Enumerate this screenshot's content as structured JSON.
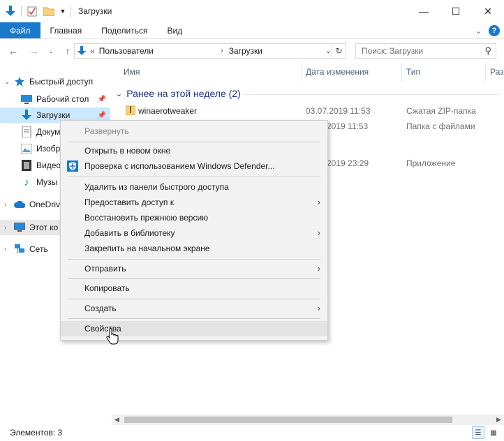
{
  "window": {
    "title": "Загрузки",
    "controls": {
      "minimize": "—",
      "maximize": "☐",
      "close": "✕"
    }
  },
  "ribbon": {
    "tabs": [
      "Файл",
      "Главная",
      "Поделиться",
      "Вид"
    ]
  },
  "address": {
    "overflow": "«",
    "segments": [
      "Пользователи",
      "Загрузки"
    ],
    "search_placeholder": "Поиск: Загрузки"
  },
  "nav": {
    "items": [
      {
        "label": "Быстрый доступ",
        "icon": "star-icon"
      },
      {
        "label": "Рабочий стол",
        "icon": "desktop-icon"
      },
      {
        "label": "Загрузки",
        "icon": "download-arrow-icon"
      },
      {
        "label": "Докум",
        "icon": "documents-icon"
      },
      {
        "label": "Изобр",
        "icon": "pictures-icon"
      },
      {
        "label": "Видео",
        "icon": "video-icon"
      },
      {
        "label": "Музы",
        "icon": "music-icon"
      },
      {
        "label": "OneDrive",
        "icon": "cloud-icon"
      },
      {
        "label": "Этот ко",
        "icon": "computer-icon"
      },
      {
        "label": "Сеть",
        "icon": "network-icon"
      }
    ]
  },
  "columns": {
    "name": "Имя",
    "date": "Дата изменения",
    "type": "Тип",
    "size": "Разм"
  },
  "group": {
    "label": "Ранее на этой неделе (2)"
  },
  "files": [
    {
      "name": "winaerotweaker",
      "date": "03.07.2019 11:53",
      "type": "Сжатая ZIP-папка"
    },
    {
      "name": "",
      "date": "2019 11:53",
      "type": "Папка с файлами"
    },
    {
      "name": "",
      "date": "2019 23:29",
      "type": "Приложение"
    }
  ],
  "context_menu": {
    "items": [
      "Развернуть",
      "Открыть в новом окне",
      "Проверка с использованием Windows Defender...",
      "Удалить из панели быстрого доступа",
      "Предоставить доступ к",
      "Восстановить прежнюю версию",
      "Добавить в библиотеку",
      "Закрепить на начальном экране",
      "Отправить",
      "Копировать",
      "Создать",
      "Свойства"
    ]
  },
  "status": {
    "count": "Элементов: 3"
  },
  "colors": {
    "accent": "#1979ca",
    "selection": "#cce8ff",
    "menu_bg": "#f2f2f2",
    "group_text": "#1e3287"
  }
}
